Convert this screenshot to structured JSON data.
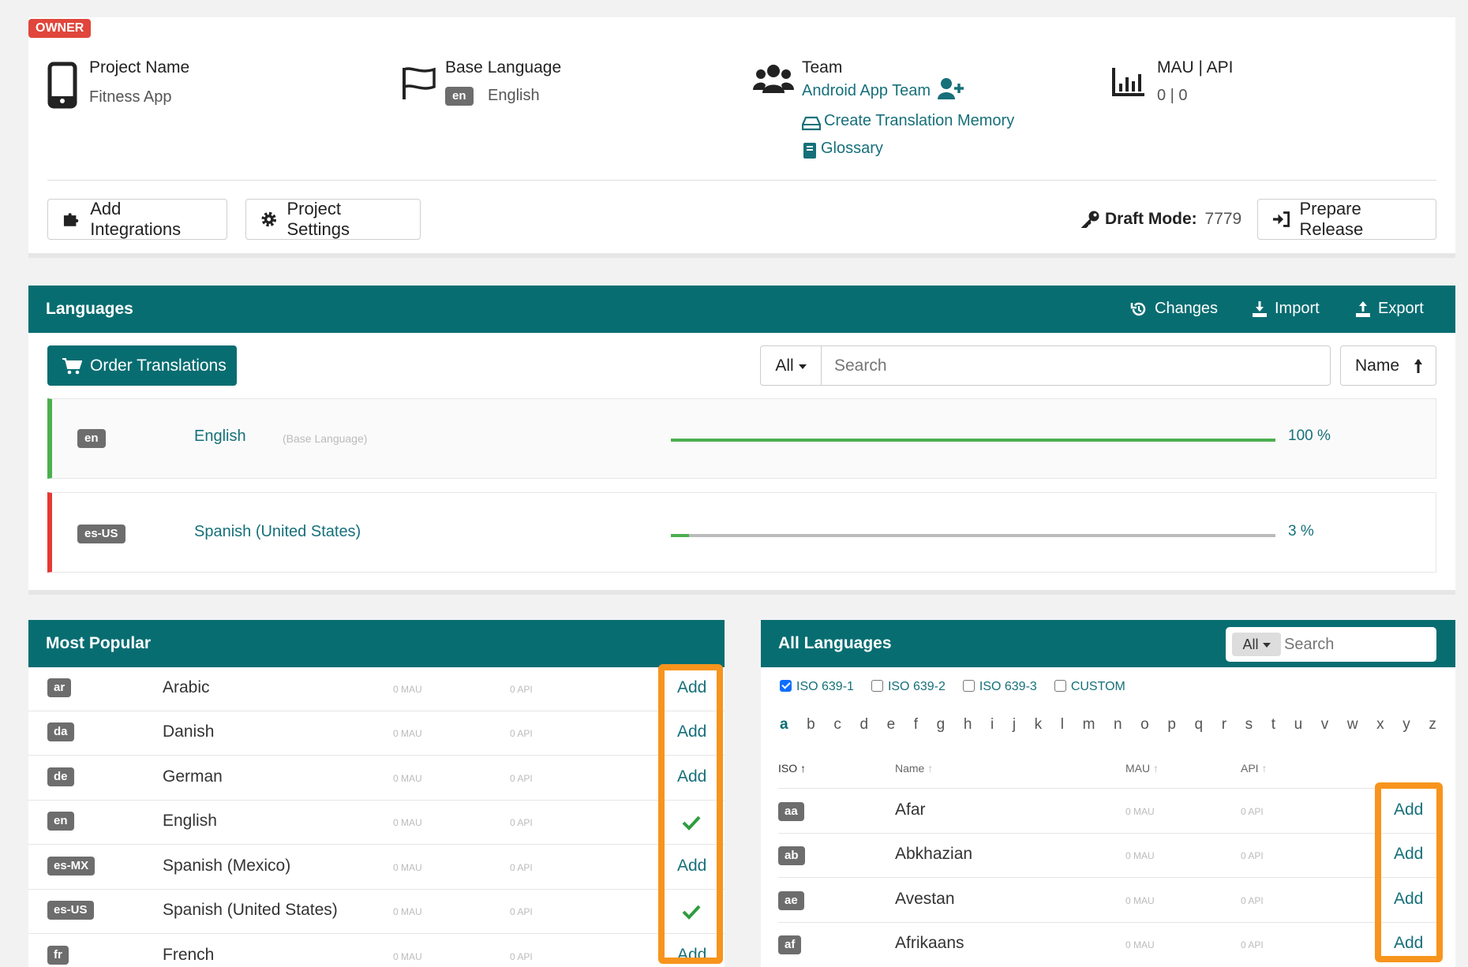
{
  "project": {
    "owner_badge": "OWNER",
    "name_label": "Project Name",
    "name_value": "Fitness App",
    "base_lang_label": "Base Language",
    "base_lang_code": "en",
    "base_lang_value": "English",
    "team_label": "Team",
    "team_value": "Android App Team",
    "create_tm_link": "Create Translation Memory",
    "glossary_link": "Glossary",
    "mau_label": "MAU | API",
    "mau_value": "0 | 0",
    "add_integrations": "Add Integrations",
    "project_settings": "Project Settings",
    "draft_label": "Draft Mode:",
    "draft_value": "7779",
    "prepare_release": "Prepare Release"
  },
  "languages_panel": {
    "title": "Languages",
    "changes": "Changes",
    "import": "Import",
    "export": "Export",
    "order_translations": "Order Translations",
    "filter_value": "All",
    "search_placeholder": "Search",
    "sort_label": "Name",
    "rows": [
      {
        "code": "en",
        "name": "English",
        "note": "(Base Language)",
        "progress_pct": 100,
        "progress_text": "100 %",
        "accent": "#4caf50"
      },
      {
        "code": "es-US",
        "name": "Spanish (United States)",
        "note": "",
        "progress_pct": 3,
        "progress_text": "3 %",
        "accent": "#e53935"
      }
    ]
  },
  "most_popular": {
    "title": "Most Popular",
    "mau_text": "0 MAU",
    "api_text": "0 API",
    "add_text": "Add",
    "rows": [
      {
        "code": "ar",
        "name": "Arabic",
        "added": false
      },
      {
        "code": "da",
        "name": "Danish",
        "added": false
      },
      {
        "code": "de",
        "name": "German",
        "added": false
      },
      {
        "code": "en",
        "name": "English",
        "added": true
      },
      {
        "code": "es-MX",
        "name": "Spanish (Mexico)",
        "added": false
      },
      {
        "code": "es-US",
        "name": "Spanish (United States)",
        "added": true
      },
      {
        "code": "fr",
        "name": "French",
        "added": false
      }
    ]
  },
  "all_languages": {
    "title": "All Languages",
    "filter_value": "All",
    "search_placeholder": "Search",
    "iso_filters": [
      {
        "label": "ISO 639-1",
        "checked": true
      },
      {
        "label": "ISO 639-2",
        "checked": false
      },
      {
        "label": "ISO 639-3",
        "checked": false
      },
      {
        "label": "CUSTOM",
        "checked": false
      }
    ],
    "letters": [
      "a",
      "b",
      "c",
      "d",
      "e",
      "f",
      "g",
      "h",
      "i",
      "j",
      "k",
      "l",
      "m",
      "n",
      "o",
      "p",
      "q",
      "r",
      "s",
      "t",
      "u",
      "v",
      "w",
      "x",
      "y",
      "z"
    ],
    "columns": {
      "iso": "ISO",
      "name": "Name",
      "mau": "MAU",
      "api": "API"
    },
    "mau_text": "0 MAU",
    "api_text": "0 API",
    "add_text": "Add",
    "rows": [
      {
        "code": "aa",
        "name": "Afar"
      },
      {
        "code": "ab",
        "name": "Abkhazian"
      },
      {
        "code": "ae",
        "name": "Avestan"
      },
      {
        "code": "af",
        "name": "Afrikaans"
      }
    ]
  },
  "colors": {
    "primary": "#086d71",
    "link": "#16707a",
    "highlight": "#f7941d",
    "owner": "#e0463c",
    "success": "#2e9d3e"
  }
}
